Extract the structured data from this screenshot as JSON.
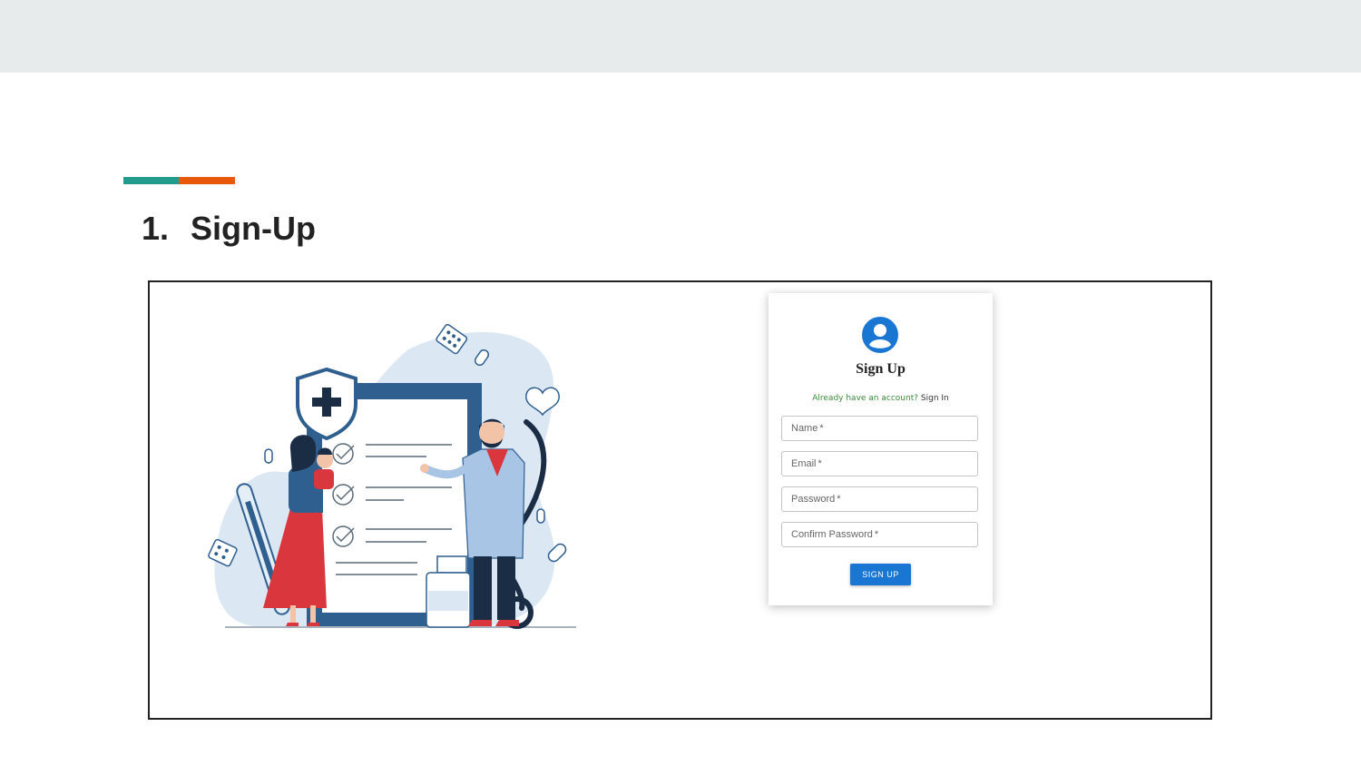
{
  "slide": {
    "number": "1.",
    "title": "Sign-Up"
  },
  "colors": {
    "accent_teal": "#1f9a8b",
    "accent_orange": "#e8590c",
    "primary_blue": "#1976d2"
  },
  "signup_card": {
    "icon": "account-circle-icon",
    "title": "Sign Up",
    "already_text": "Already have an account?",
    "signin_link": "Sign In",
    "fields": [
      {
        "label": "Name",
        "required": "*"
      },
      {
        "label": "Email",
        "required": "*"
      },
      {
        "label": "Password",
        "required": "*"
      },
      {
        "label": "Confirm Password",
        "required": "*"
      }
    ],
    "submit_label": "SIGN UP"
  },
  "illustration": {
    "icon": "healthcare-illustration"
  }
}
